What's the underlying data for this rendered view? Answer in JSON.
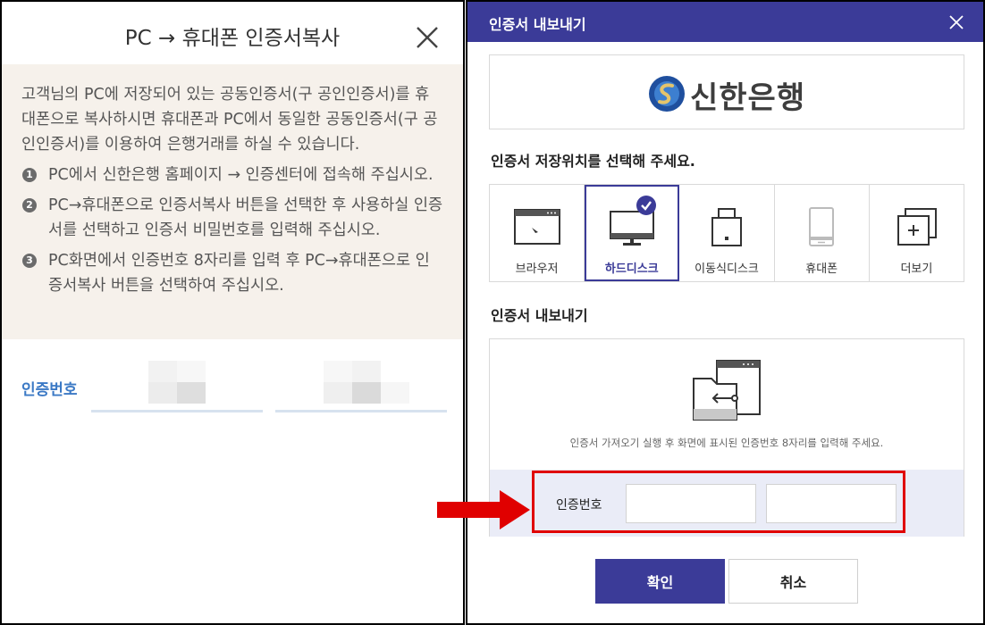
{
  "left_panel": {
    "title": "PC → 휴대폰 인증서복사",
    "intro": "고객님의 PC에 저장되어 있는 공동인증서(구 공인인증서)를 휴대폰으로 복사하시면 휴대폰과 PC에서 동일한 공동인증서(구 공인인증서)를 이용하여 은행거래를 하실 수 있습니다.",
    "steps": [
      {
        "num": "1",
        "text": "PC에서 신한은행 홈페이지 → 인증센터에 접속해 주십시오."
      },
      {
        "num": "2",
        "text": "PC→휴대폰으로 인증서복사 버튼을 선택한 후 사용하실 인증서를 선택하고 인증서 비밀번호를 입력해 주십시오."
      },
      {
        "num": "3",
        "text": "PC화면에서 인증번호 8자리를 입력 후 PC→휴대폰으로 인증서복사 버튼을 선택하여 주십시오."
      }
    ],
    "auth_label": "인증번호",
    "close_icon": "close-icon",
    "colors": {
      "info_bg": "#f6f1eb",
      "label": "#3b79c5",
      "underline": "#d7e2ef"
    }
  },
  "dialog": {
    "title": "인증서 내보내기",
    "close_icon": "close-icon",
    "bank_name": "신한은행",
    "location_prompt": "인증서 저장위치를 선택해 주세요.",
    "locations": [
      {
        "label": "브라우저",
        "icon": "browser-icon",
        "selected": false
      },
      {
        "label": "하드디스크",
        "icon": "monitor-icon",
        "selected": true
      },
      {
        "label": "이동식디스크",
        "icon": "usb-drive-icon",
        "selected": false
      },
      {
        "label": "휴대폰",
        "icon": "phone-icon",
        "selected": false
      },
      {
        "label": "더보기",
        "icon": "more-icon",
        "selected": false
      }
    ],
    "export_title": "인증서 내보내기",
    "export_guide": "인증서 가져오기 실행 후 화면에 표시된 인증번호 8자리를 입력해 주세요.",
    "auth_label": "인증번호",
    "auth_input_1": "",
    "auth_input_2": "",
    "confirm_label": "확인",
    "cancel_label": "취소",
    "colors": {
      "header": "#3b3b98",
      "input_band": "#eaecf7",
      "highlight": "#e00000"
    }
  }
}
